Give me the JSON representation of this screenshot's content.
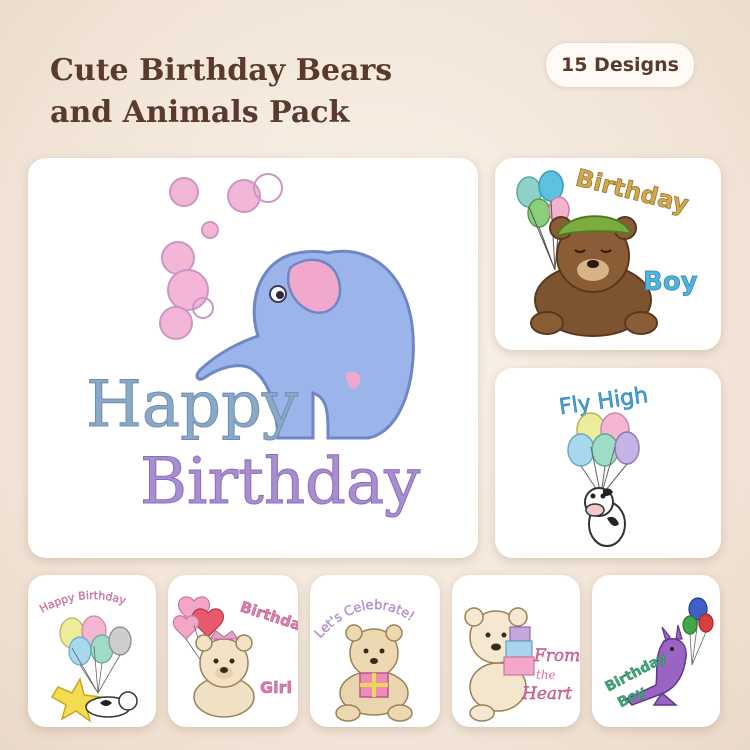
{
  "header": {
    "title_line1": "Cute Birthday Bears",
    "title_line2": "and Animals Pack",
    "badge": "15 Designs"
  },
  "designs": {
    "main": {
      "line1": "Happy",
      "line2": "Birthday",
      "icon": "elephant-with-bubbles"
    },
    "bear_boy": {
      "line1": "Birthday",
      "line2": "Boy",
      "icon": "bear-with-cap-and-balloons"
    },
    "fly_high": {
      "text": "Fly High",
      "icon": "cow-with-balloons"
    },
    "cow_star": {
      "text": "Happy Birthday",
      "icon": "cow-on-star"
    },
    "bear_girl": {
      "line1": "Birthday",
      "line2": "Girl",
      "icon": "bear-with-heart-balloons"
    },
    "celebrate": {
      "text": "Let's Celebrate!",
      "icon": "bear-with-gift"
    },
    "from_heart": {
      "line1": "From",
      "line2": "the",
      "line3": "Heart",
      "icon": "bear-with-gift-stack"
    },
    "kangaroo": {
      "line1": "Birthday",
      "line2": "Boy",
      "icon": "kangaroo-with-balloons"
    }
  },
  "colors": {
    "title": "#5a3a2c",
    "elephant": "#93aee6",
    "bubble": "#f0a9cc",
    "happy_text": "#8aa9c8",
    "birthday_text": "#9c7fc4"
  }
}
